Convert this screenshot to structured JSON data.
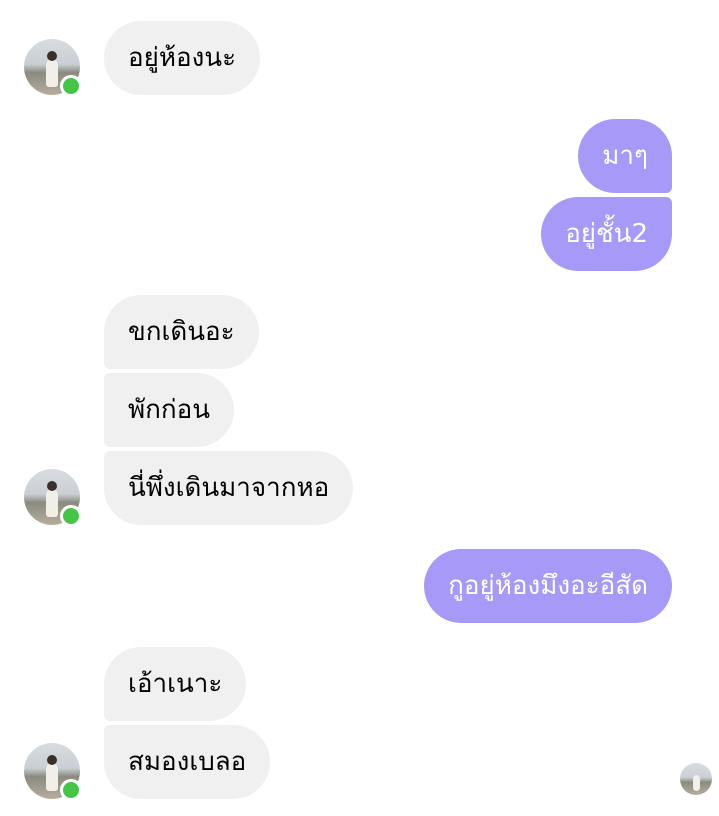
{
  "messages": [
    {
      "id": "m1",
      "side": "in",
      "text": "อยู่ห้องนะ"
    },
    {
      "id": "m2",
      "side": "out",
      "text": "มาๆ"
    },
    {
      "id": "m3",
      "side": "out",
      "text": "อยู่ชั้น2"
    },
    {
      "id": "m4",
      "side": "in",
      "text": "ขกเดินอะ"
    },
    {
      "id": "m5",
      "side": "in",
      "text": "พักก่อน"
    },
    {
      "id": "m6",
      "side": "in",
      "text": "นี่พึ่งเดินมาจากหอ"
    },
    {
      "id": "m7",
      "side": "out",
      "text": "กูอยู่ห้องมึงอะอีสัด"
    },
    {
      "id": "m8",
      "side": "in",
      "text": "เอ้าเนาะ"
    },
    {
      "id": "m9",
      "side": "in",
      "text": "สมองเบลอ"
    }
  ],
  "colors": {
    "outgoing_bubble": "#a799f7",
    "incoming_bubble": "#f0f0f0",
    "online_indicator": "#44c545"
  },
  "icons": {
    "contact_avatar": "contact-avatar",
    "online_dot": "online-status-indicator",
    "read_receipt": "read-receipt-avatar"
  }
}
